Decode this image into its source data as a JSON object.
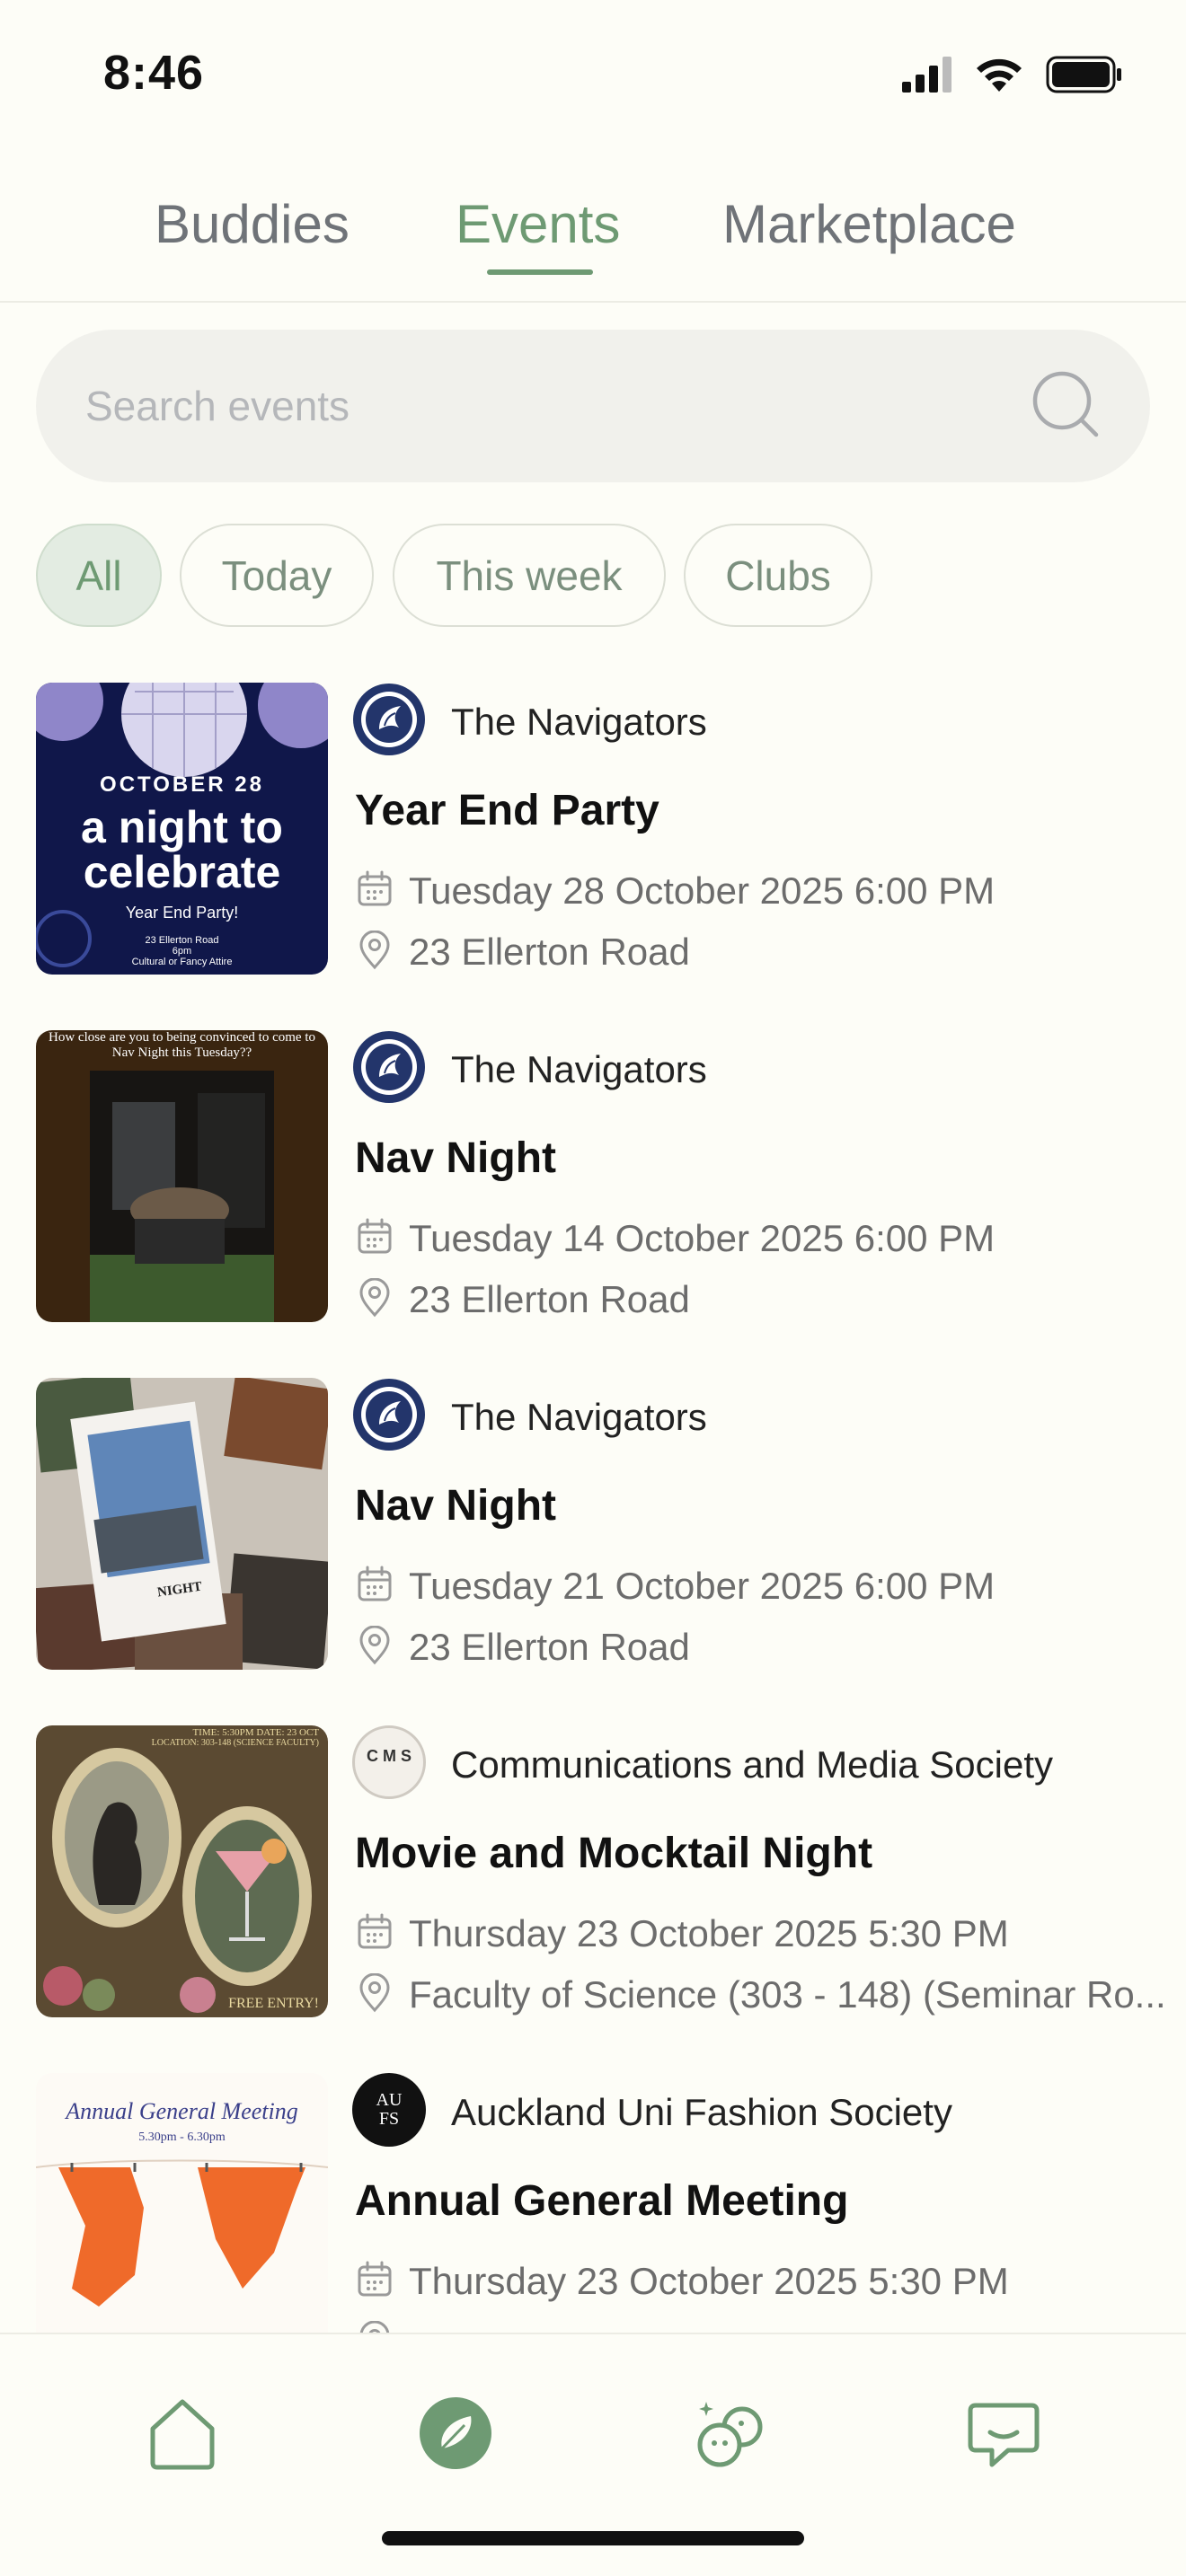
{
  "status": {
    "time": "8:46"
  },
  "tabs": [
    {
      "label": "Buddies"
    },
    {
      "label": "Events"
    },
    {
      "label": "Marketplace"
    }
  ],
  "search": {
    "placeholder": "Search events"
  },
  "filters": [
    {
      "label": "All"
    },
    {
      "label": "Today"
    },
    {
      "label": "This week"
    },
    {
      "label": "Clubs"
    }
  ],
  "events": [
    {
      "org": "The Navigators",
      "title": "Year End Party",
      "date": "Tuesday 28 October 2025 6:00 PM",
      "location": "23 Ellerton Road",
      "thumb": {
        "line1": "OCTOBER 28",
        "line2": "a night to",
        "line3": "celebrate",
        "line4": "Year End Party!",
        "line5": "23 Ellerton Road",
        "line6": "6pm",
        "line7": "Cultural or Fancy Attire"
      }
    },
    {
      "org": "The Navigators",
      "title": "Nav Night",
      "date": "Tuesday 14 October 2025 6:00 PM",
      "location": "23 Ellerton Road",
      "thumb": {
        "caption": "How close are you to being convinced to come to Nav Night this Tuesday??"
      }
    },
    {
      "org": "The Navigators",
      "title": "Nav Night",
      "date": "Tuesday 21 October 2025 6:00 PM",
      "location": "23 Ellerton Road",
      "thumb": {
        "caption": "NIGHT"
      }
    },
    {
      "org": "Communications and Media Society",
      "title": "Movie and Mocktail Night",
      "date": "Thursday 23 October 2025 5:30 PM",
      "location": "Faculty of Science (303 - 148) (Seminar Ro...",
      "avatar_text": "C M S",
      "thumb": {
        "line1": "TIME: 5:30PM DATE: 23 OCT",
        "line2": "LOCATION: 303-148 (SCIENCE FACULTY)",
        "line3": "FREE ENTRY!"
      }
    },
    {
      "org": "Auckland Uni Fashion Society",
      "title": "Annual General Meeting",
      "date": "Thursday 23 October 2025 5:30 PM",
      "location": "",
      "avatar_text": "AU FS",
      "thumb": {
        "line1": "Annual General Meeting",
        "line2": "5.30pm - 6.30pm"
      }
    }
  ],
  "nav": [
    {
      "icon": "home-icon"
    },
    {
      "icon": "compass-icon"
    },
    {
      "icon": "buddies-icon"
    },
    {
      "icon": "chat-icon"
    }
  ],
  "colors": {
    "accent": "#6e9a73",
    "background": "#fdfdf7",
    "navy": "#23356b"
  }
}
